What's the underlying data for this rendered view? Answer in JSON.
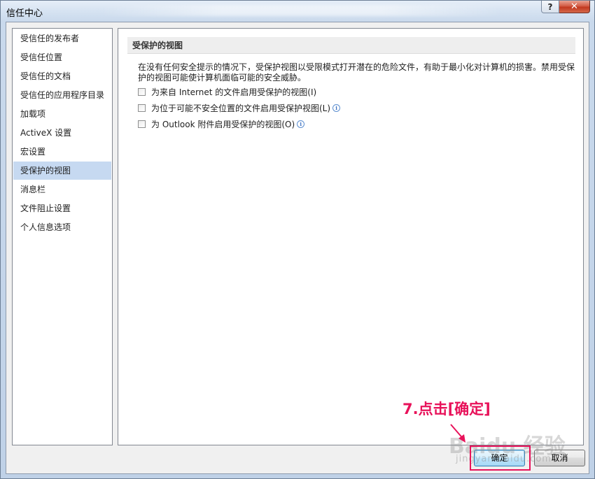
{
  "window": {
    "title": "信任中心",
    "help_label": "?",
    "close_label": "✕"
  },
  "sidebar": {
    "items": [
      {
        "label": "受信任的发布者"
      },
      {
        "label": "受信任位置"
      },
      {
        "label": "受信任的文档"
      },
      {
        "label": "受信任的应用程序目录"
      },
      {
        "label": "加载项"
      },
      {
        "label": "ActiveX 设置"
      },
      {
        "label": "宏设置"
      },
      {
        "label": "受保护的视图",
        "selected": true
      },
      {
        "label": "消息栏"
      },
      {
        "label": "文件阻止设置"
      },
      {
        "label": "个人信息选项"
      }
    ]
  },
  "content": {
    "section_title": "受保护的视图",
    "description": "在没有任何安全提示的情况下，受保护视图以受限模式打开潜在的危险文件，有助于最小化对计算机的损害。禁用受保护的视图可能使计算机面临可能的安全威胁。",
    "options": [
      {
        "label": "为来自 Internet 的文件启用受保护的视图(I)",
        "checked": false,
        "has_info": false
      },
      {
        "label": "为位于可能不安全位置的文件启用受保护视图(L)",
        "checked": false,
        "has_info": true
      },
      {
        "label": "为 Outlook 附件启用受保护的视图(O)",
        "checked": false,
        "has_info": true
      }
    ]
  },
  "buttons": {
    "ok_label": "确定",
    "cancel_label": "取消"
  },
  "annotation": {
    "text": "7.点击[确定]",
    "color": "#e8125a"
  },
  "watermark": {
    "text": "Baidu 经验",
    "sub": "jingyan.baidu.com"
  }
}
